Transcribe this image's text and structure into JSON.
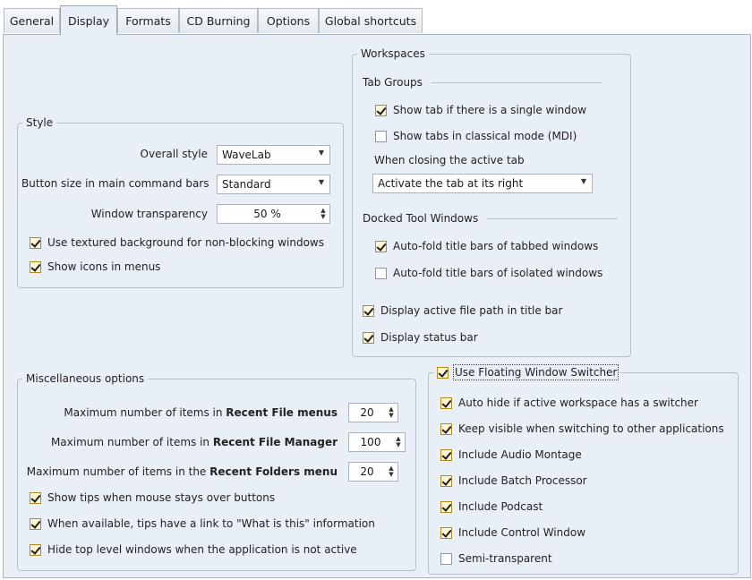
{
  "tabs": [
    {
      "label": "General",
      "active": false
    },
    {
      "label": "Display",
      "active": true
    },
    {
      "label": "Formats",
      "active": false
    },
    {
      "label": "CD Burning",
      "active": false
    },
    {
      "label": "Options",
      "active": false
    },
    {
      "label": "Global shortcuts",
      "active": false
    }
  ],
  "style": {
    "title": "Style",
    "overall_style_label": "Overall style",
    "overall_style_value": "WaveLab",
    "button_size_label": "Button size in main command bars",
    "button_size_value": "Standard",
    "transparency_label": "Window transparency",
    "transparency_value": "50 %",
    "textured_bg": {
      "label": "Use textured background for non-blocking windows",
      "checked": true
    },
    "icons_in_menus": {
      "label": "Show icons in menus",
      "checked": true
    }
  },
  "workspaces": {
    "title": "Workspaces",
    "tab_groups_title": "Tab Groups",
    "show_tab_single": {
      "label": "Show tab if there is a single window",
      "checked": true
    },
    "classical_mode": {
      "label": "Show tabs in classical mode (MDI)",
      "checked": false
    },
    "closing_label": "When closing the active tab",
    "closing_value": "Activate the tab at its right",
    "docked_title": "Docked Tool Windows",
    "autofold_tabbed": {
      "label": "Auto-fold title bars of tabbed windows",
      "checked": true
    },
    "autofold_isolated": {
      "label": "Auto-fold title bars of isolated windows",
      "checked": false
    },
    "file_path": {
      "label": "Display active file path in title bar",
      "checked": true
    },
    "status_bar": {
      "label": "Display status bar",
      "checked": true
    }
  },
  "misc": {
    "title": "Miscellaneous options",
    "recent_file_menus": {
      "prefix": "Maximum number of items in ",
      "bold": "Recent File menus",
      "value": "20"
    },
    "recent_file_manager": {
      "prefix": "Maximum number of items in ",
      "bold": "Recent File Manager",
      "value": "100"
    },
    "recent_folders": {
      "prefix": "Maximum number of items in the ",
      "bold": "Recent Folders menu",
      "value": "20"
    },
    "show_tips": {
      "label": "Show tips when mouse stays over buttons",
      "checked": true
    },
    "tips_link": {
      "label": "When available, tips have a link to \"What is this\" information",
      "checked": true
    },
    "hide_top": {
      "label": "Hide top level windows when the application is not active",
      "checked": true
    }
  },
  "switcher": {
    "title": {
      "label": "Use Floating Window Switcher",
      "checked": true
    },
    "auto_hide": {
      "label": "Auto hide if active workspace has a switcher",
      "checked": true
    },
    "keep_visible": {
      "label": "Keep visible when switching to other applications",
      "checked": true
    },
    "audio_montage": {
      "label": "Include Audio Montage",
      "checked": true
    },
    "batch_processor": {
      "label": "Include Batch Processor",
      "checked": true
    },
    "podcast": {
      "label": "Include Podcast",
      "checked": true
    },
    "control_window": {
      "label": "Include Control Window",
      "checked": true
    },
    "semi_transparent": {
      "label": "Semi-transparent",
      "checked": false
    }
  },
  "colors": {
    "pane_bg": "#e9eff6",
    "check_box_on": "#fff6d6",
    "check_border_on": "#b08a1e"
  },
  "icons": {
    "dropdown": "chevron-down-icon",
    "spinner": "up-down-arrows-icon",
    "check": "checkmark-icon"
  }
}
